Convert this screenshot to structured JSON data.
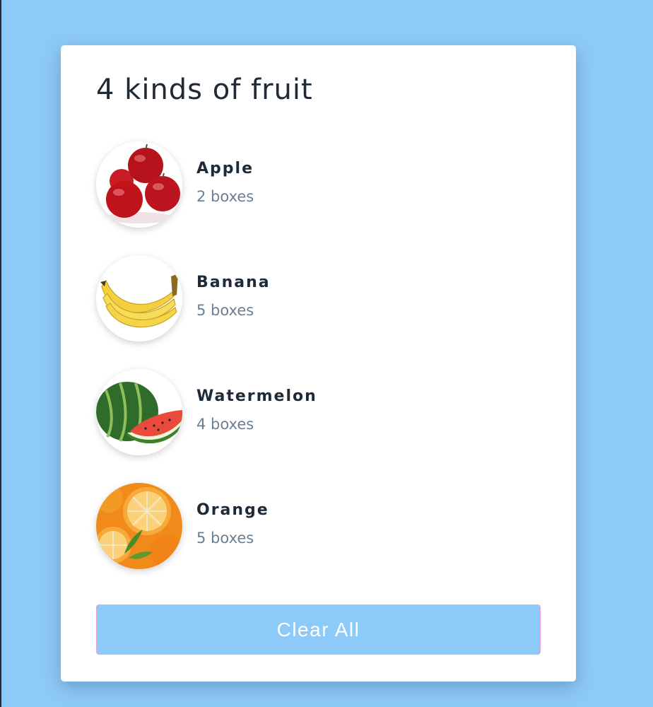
{
  "page": {
    "background_color": "#8ecaf8"
  },
  "card": {
    "title": "4 kinds of fruit",
    "items": [
      {
        "name": "Apple",
        "quantity": "2 boxes",
        "icon": "apple-icon"
      },
      {
        "name": "Banana",
        "quantity": "5 boxes",
        "icon": "banana-icon"
      },
      {
        "name": "Watermelon",
        "quantity": "4 boxes",
        "icon": "watermelon-icon"
      },
      {
        "name": "Orange",
        "quantity": "5 boxes",
        "icon": "orange-icon"
      }
    ],
    "clear_button_label": "Clear All"
  }
}
